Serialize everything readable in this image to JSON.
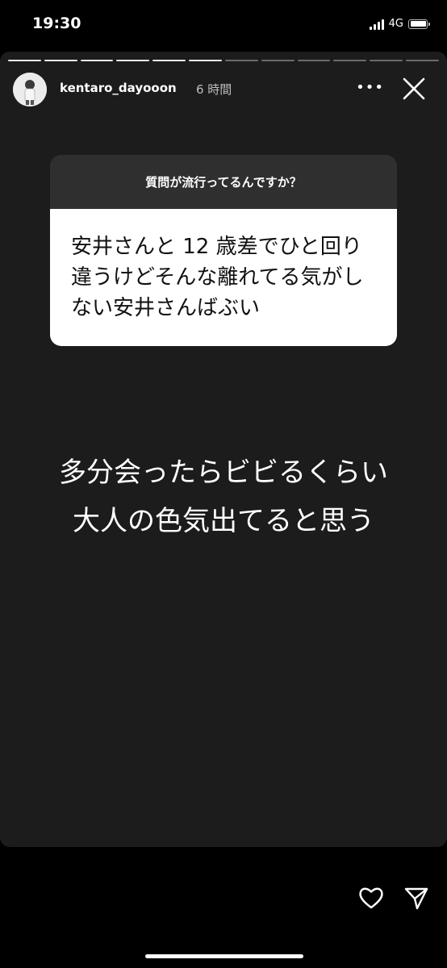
{
  "status_bar": {
    "time": "19:30",
    "network": "4G"
  },
  "story": {
    "progress_segments": 12,
    "progress_completed": 6,
    "username": "kentaro_dayooon",
    "time_ago": "6 時間",
    "more_icon": "•••",
    "question": {
      "prompt": "質問が流行ってるんですか？",
      "answer": "安井さんと 12 歳差でひと回り違うけどそんな離れてる気がしない安井さんばぶい"
    },
    "caption_lines": [
      "多分会ったらビビるくらい",
      "大人の色気出てると思う"
    ]
  },
  "icons": {
    "heart": "heart-icon",
    "send": "send-icon",
    "close": "close-icon"
  },
  "colors": {
    "background": "#000000",
    "story_bg": "#1c1c1c",
    "sticker_header": "#2f2f2f",
    "sticker_body": "#ffffff"
  }
}
